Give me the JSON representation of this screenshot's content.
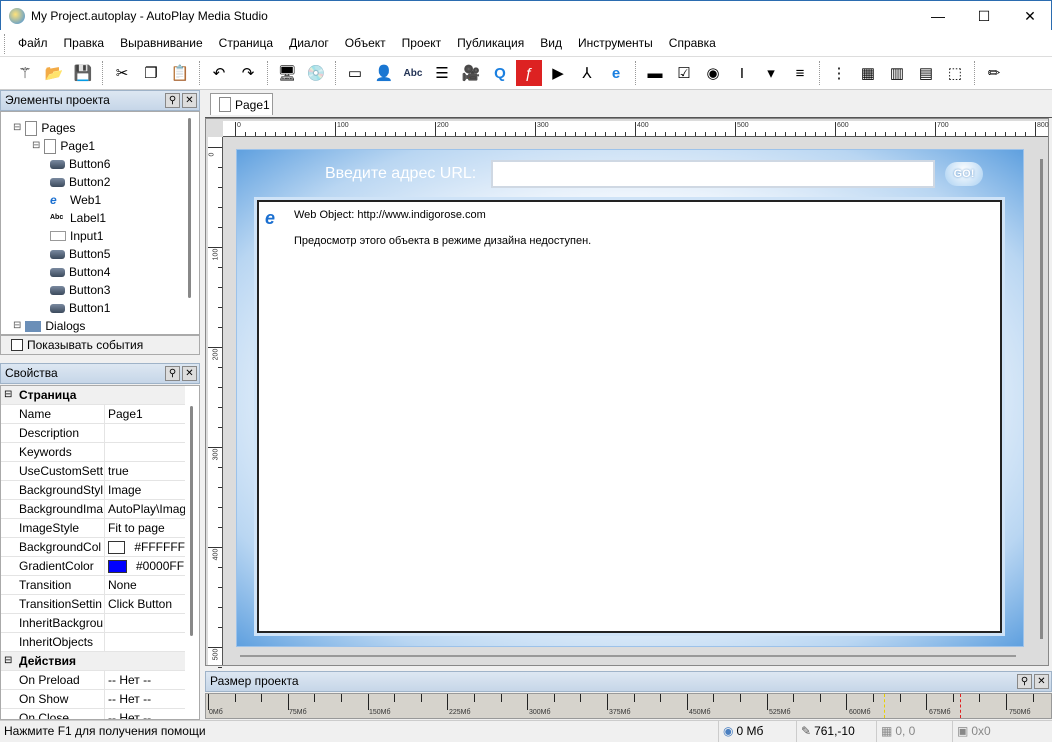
{
  "window": {
    "title": "My Project.autoplay - AutoPlay Media Studio",
    "minimize": "—",
    "maximize": "☐",
    "close": "✕"
  },
  "menu": [
    "Файл",
    "Правка",
    "Выравнивание",
    "Страница",
    "Диалог",
    "Объект",
    "Проект",
    "Публикация",
    "Вид",
    "Инструменты",
    "Справка"
  ],
  "toolbar": [
    "wand-icon",
    "open-folder-icon",
    "save-icon",
    "|",
    "cut-icon",
    "copy-icon",
    "paste-icon",
    "|",
    "undo-icon",
    "redo-icon",
    "|",
    "preview-icon",
    "publish-disc-icon",
    "|",
    "button-object-icon",
    "image-object-icon",
    "label-object-icon",
    "paragraph-object-icon",
    "video-object-icon",
    "quicktime-object-icon",
    "flash-object-icon",
    "slideshow-object-icon",
    "pdf-object-icon",
    "web-object-icon",
    "|",
    "input-object-icon",
    "checkbox-object-icon",
    "radio-object-icon",
    "textfield-object-icon",
    "combobox-object-icon",
    "listbox-object-icon",
    "|",
    "tree-object-icon",
    "grid-object-icon",
    "progress-object-icon",
    "xbutton-object-icon",
    "hotspot-object-icon",
    "|",
    "pen-icon"
  ],
  "project_panel": {
    "title": "Элементы проекта",
    "tree": [
      {
        "label": "Pages",
        "level": 0,
        "icon": "pages"
      },
      {
        "label": "Page1",
        "level": 1,
        "icon": "page"
      },
      {
        "label": "Button6",
        "level": 2,
        "icon": "button"
      },
      {
        "label": "Button2",
        "level": 2,
        "icon": "button"
      },
      {
        "label": "Web1",
        "level": 2,
        "icon": "web"
      },
      {
        "label": "Label1",
        "level": 2,
        "icon": "label"
      },
      {
        "label": "Input1",
        "level": 2,
        "icon": "input"
      },
      {
        "label": "Button5",
        "level": 2,
        "icon": "button"
      },
      {
        "label": "Button4",
        "level": 2,
        "icon": "button"
      },
      {
        "label": "Button3",
        "level": 2,
        "icon": "button"
      },
      {
        "label": "Button1",
        "level": 2,
        "icon": "button"
      },
      {
        "label": "Dialogs",
        "level": 0,
        "icon": "dialogs"
      }
    ],
    "show_events": "Показывать события"
  },
  "properties_panel": {
    "title": "Свойства",
    "rows": [
      {
        "cat": true,
        "key": "Страница"
      },
      {
        "key": "Name",
        "value": "Page1"
      },
      {
        "key": "Description",
        "value": ""
      },
      {
        "key": "Keywords",
        "value": ""
      },
      {
        "key": "UseCustomSett",
        "value": "true"
      },
      {
        "key": "BackgroundStyl",
        "value": "Image"
      },
      {
        "key": "BackgroundIma",
        "value": "AutoPlay\\Imag"
      },
      {
        "key": "ImageStyle",
        "value": "Fit to page"
      },
      {
        "key": "BackgroundCol",
        "value": "#FFFFFF",
        "swatch": "#FFFFFF"
      },
      {
        "key": "GradientColor",
        "value": "#0000FF",
        "swatch": "#0000FF"
      },
      {
        "key": "Transition",
        "value": "None"
      },
      {
        "key": "TransitionSettin",
        "value": "Click Button"
      },
      {
        "key": "InheritBackgrou",
        "value": ""
      },
      {
        "key": "InheritObjects",
        "value": ""
      },
      {
        "cat": true,
        "key": "Действия"
      },
      {
        "key": "On Preload",
        "value": "-- Нет --"
      },
      {
        "key": "On Show",
        "value": "-- Нет --"
      },
      {
        "key": "On Close",
        "value": "-- Нет --"
      }
    ]
  },
  "tab": {
    "label": "Page1"
  },
  "rulers": {
    "h": [
      "0",
      "100",
      "200",
      "300",
      "400",
      "500",
      "600",
      "700",
      "800"
    ],
    "v": [
      "0",
      "100",
      "200",
      "300",
      "400",
      "500"
    ]
  },
  "page": {
    "url_label": "Введите адрес URL:",
    "url_value": "",
    "go_label": "GO!",
    "web_title": "Web Object: http://www.indigorose.com",
    "web_message": "Предосмотр этого объекта в режиме дизайна недоступен."
  },
  "size_panel": {
    "title": "Размер проекта",
    "labels": [
      "0Мб",
      "75Мб",
      "150Мб",
      "225Мб",
      "300Мб",
      "375Мб",
      "450Мб",
      "525Мб",
      "600Мб",
      "675Мб",
      "750Мб"
    ]
  },
  "status": {
    "help": "Нажмите F1 для получения помощи",
    "size": "0 Мб",
    "coords": "761,-10",
    "position": "0, 0",
    "dimensions": "0x0"
  }
}
